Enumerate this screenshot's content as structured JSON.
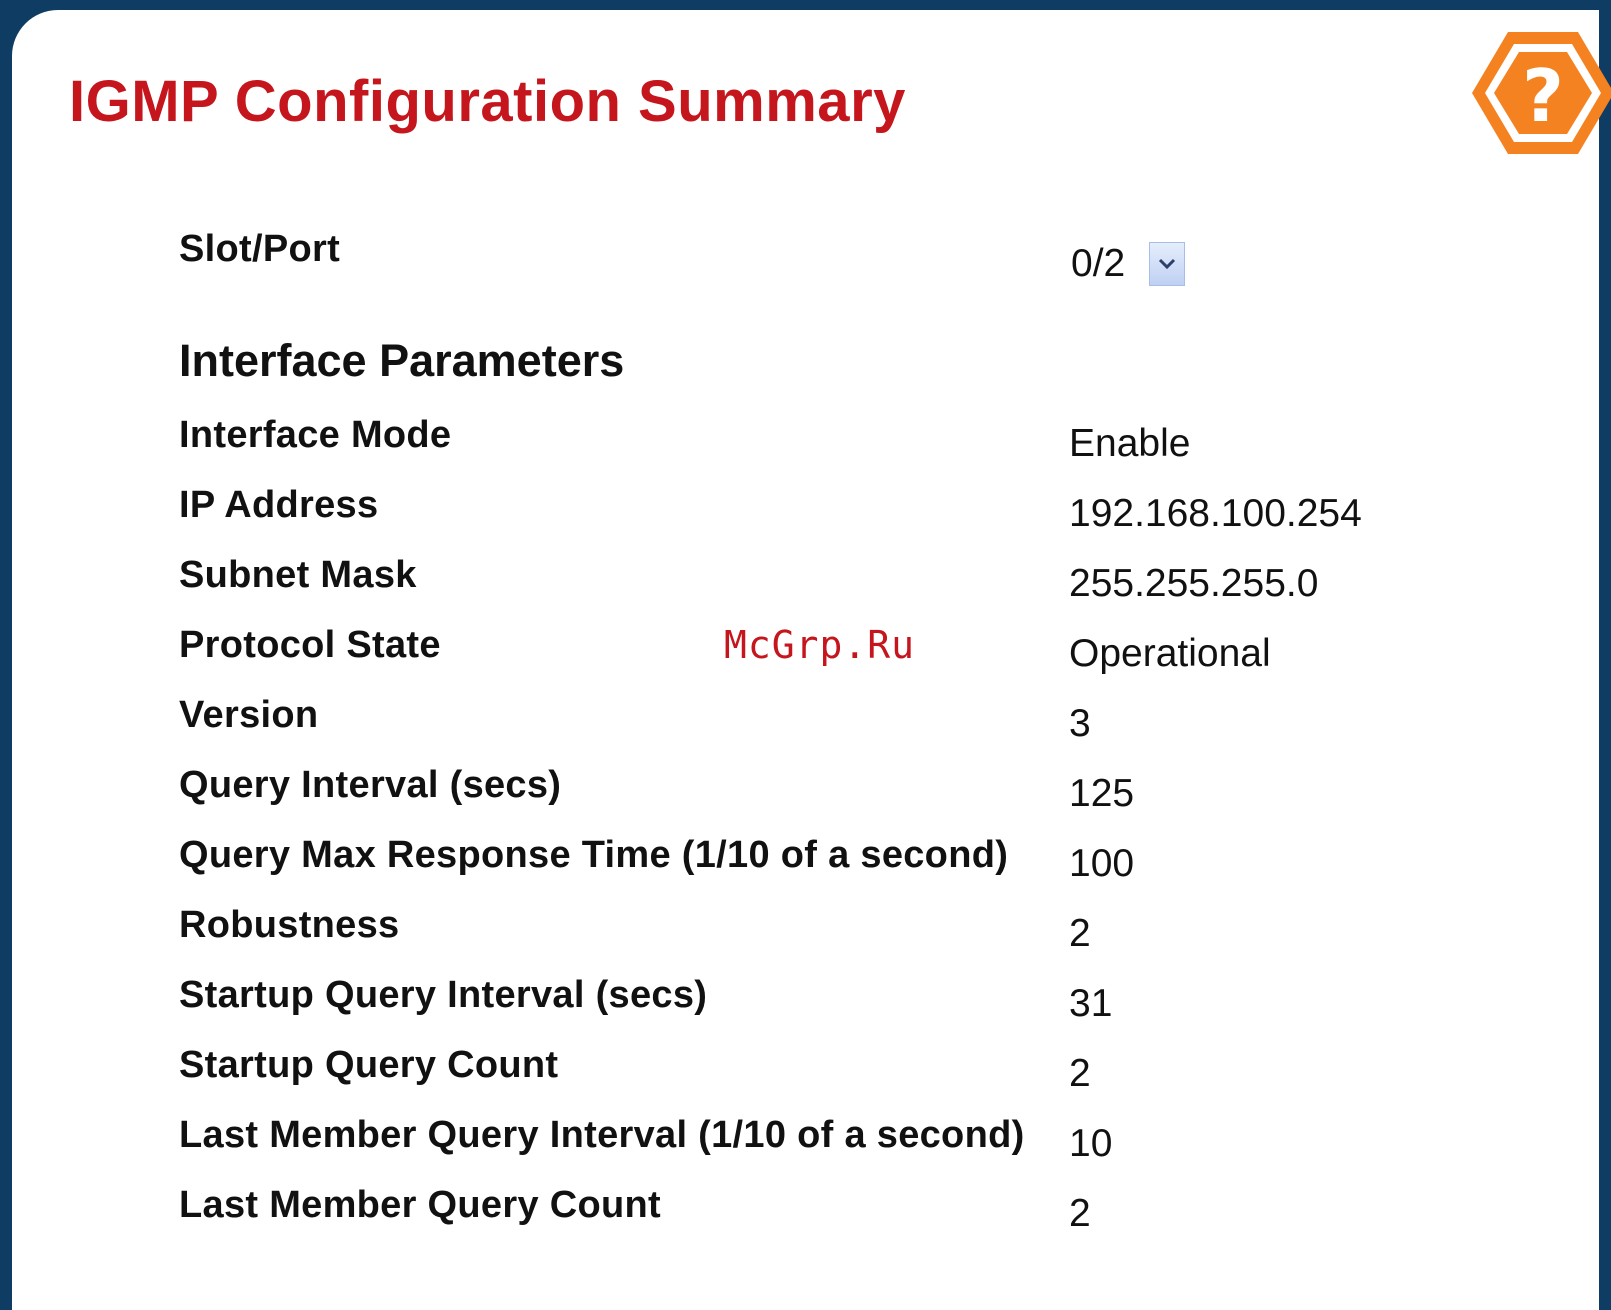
{
  "page": {
    "title": "IGMP Configuration Summary",
    "help_icon": "question-mark-hexagon-icon",
    "accent_color": "#c4161c",
    "help_color": "#f58220"
  },
  "slot_port": {
    "label": "Slot/Port",
    "selected": "0/2"
  },
  "section_title": "Interface Parameters",
  "params": [
    {
      "label": "Interface Mode",
      "value": "Enable"
    },
    {
      "label": "IP Address",
      "value": "192.168.100.254"
    },
    {
      "label": "Subnet Mask",
      "value": "255.255.255.0"
    },
    {
      "label": "Protocol State",
      "value": "Operational"
    },
    {
      "label": "Version",
      "value": "3"
    },
    {
      "label": "Query Interval (secs)",
      "value": "125"
    },
    {
      "label": "Query Max Response Time (1/10 of a second)",
      "value": "100"
    },
    {
      "label": "Robustness",
      "value": "2"
    },
    {
      "label": "Startup Query Interval (secs)",
      "value": "31"
    },
    {
      "label": "Startup Query Count",
      "value": "2"
    },
    {
      "label": "Last Member Query Interval (1/10 of a second)",
      "value": "10"
    },
    {
      "label": "Last Member Query Count",
      "value": "2"
    }
  ],
  "watermark": "McGrp.Ru"
}
